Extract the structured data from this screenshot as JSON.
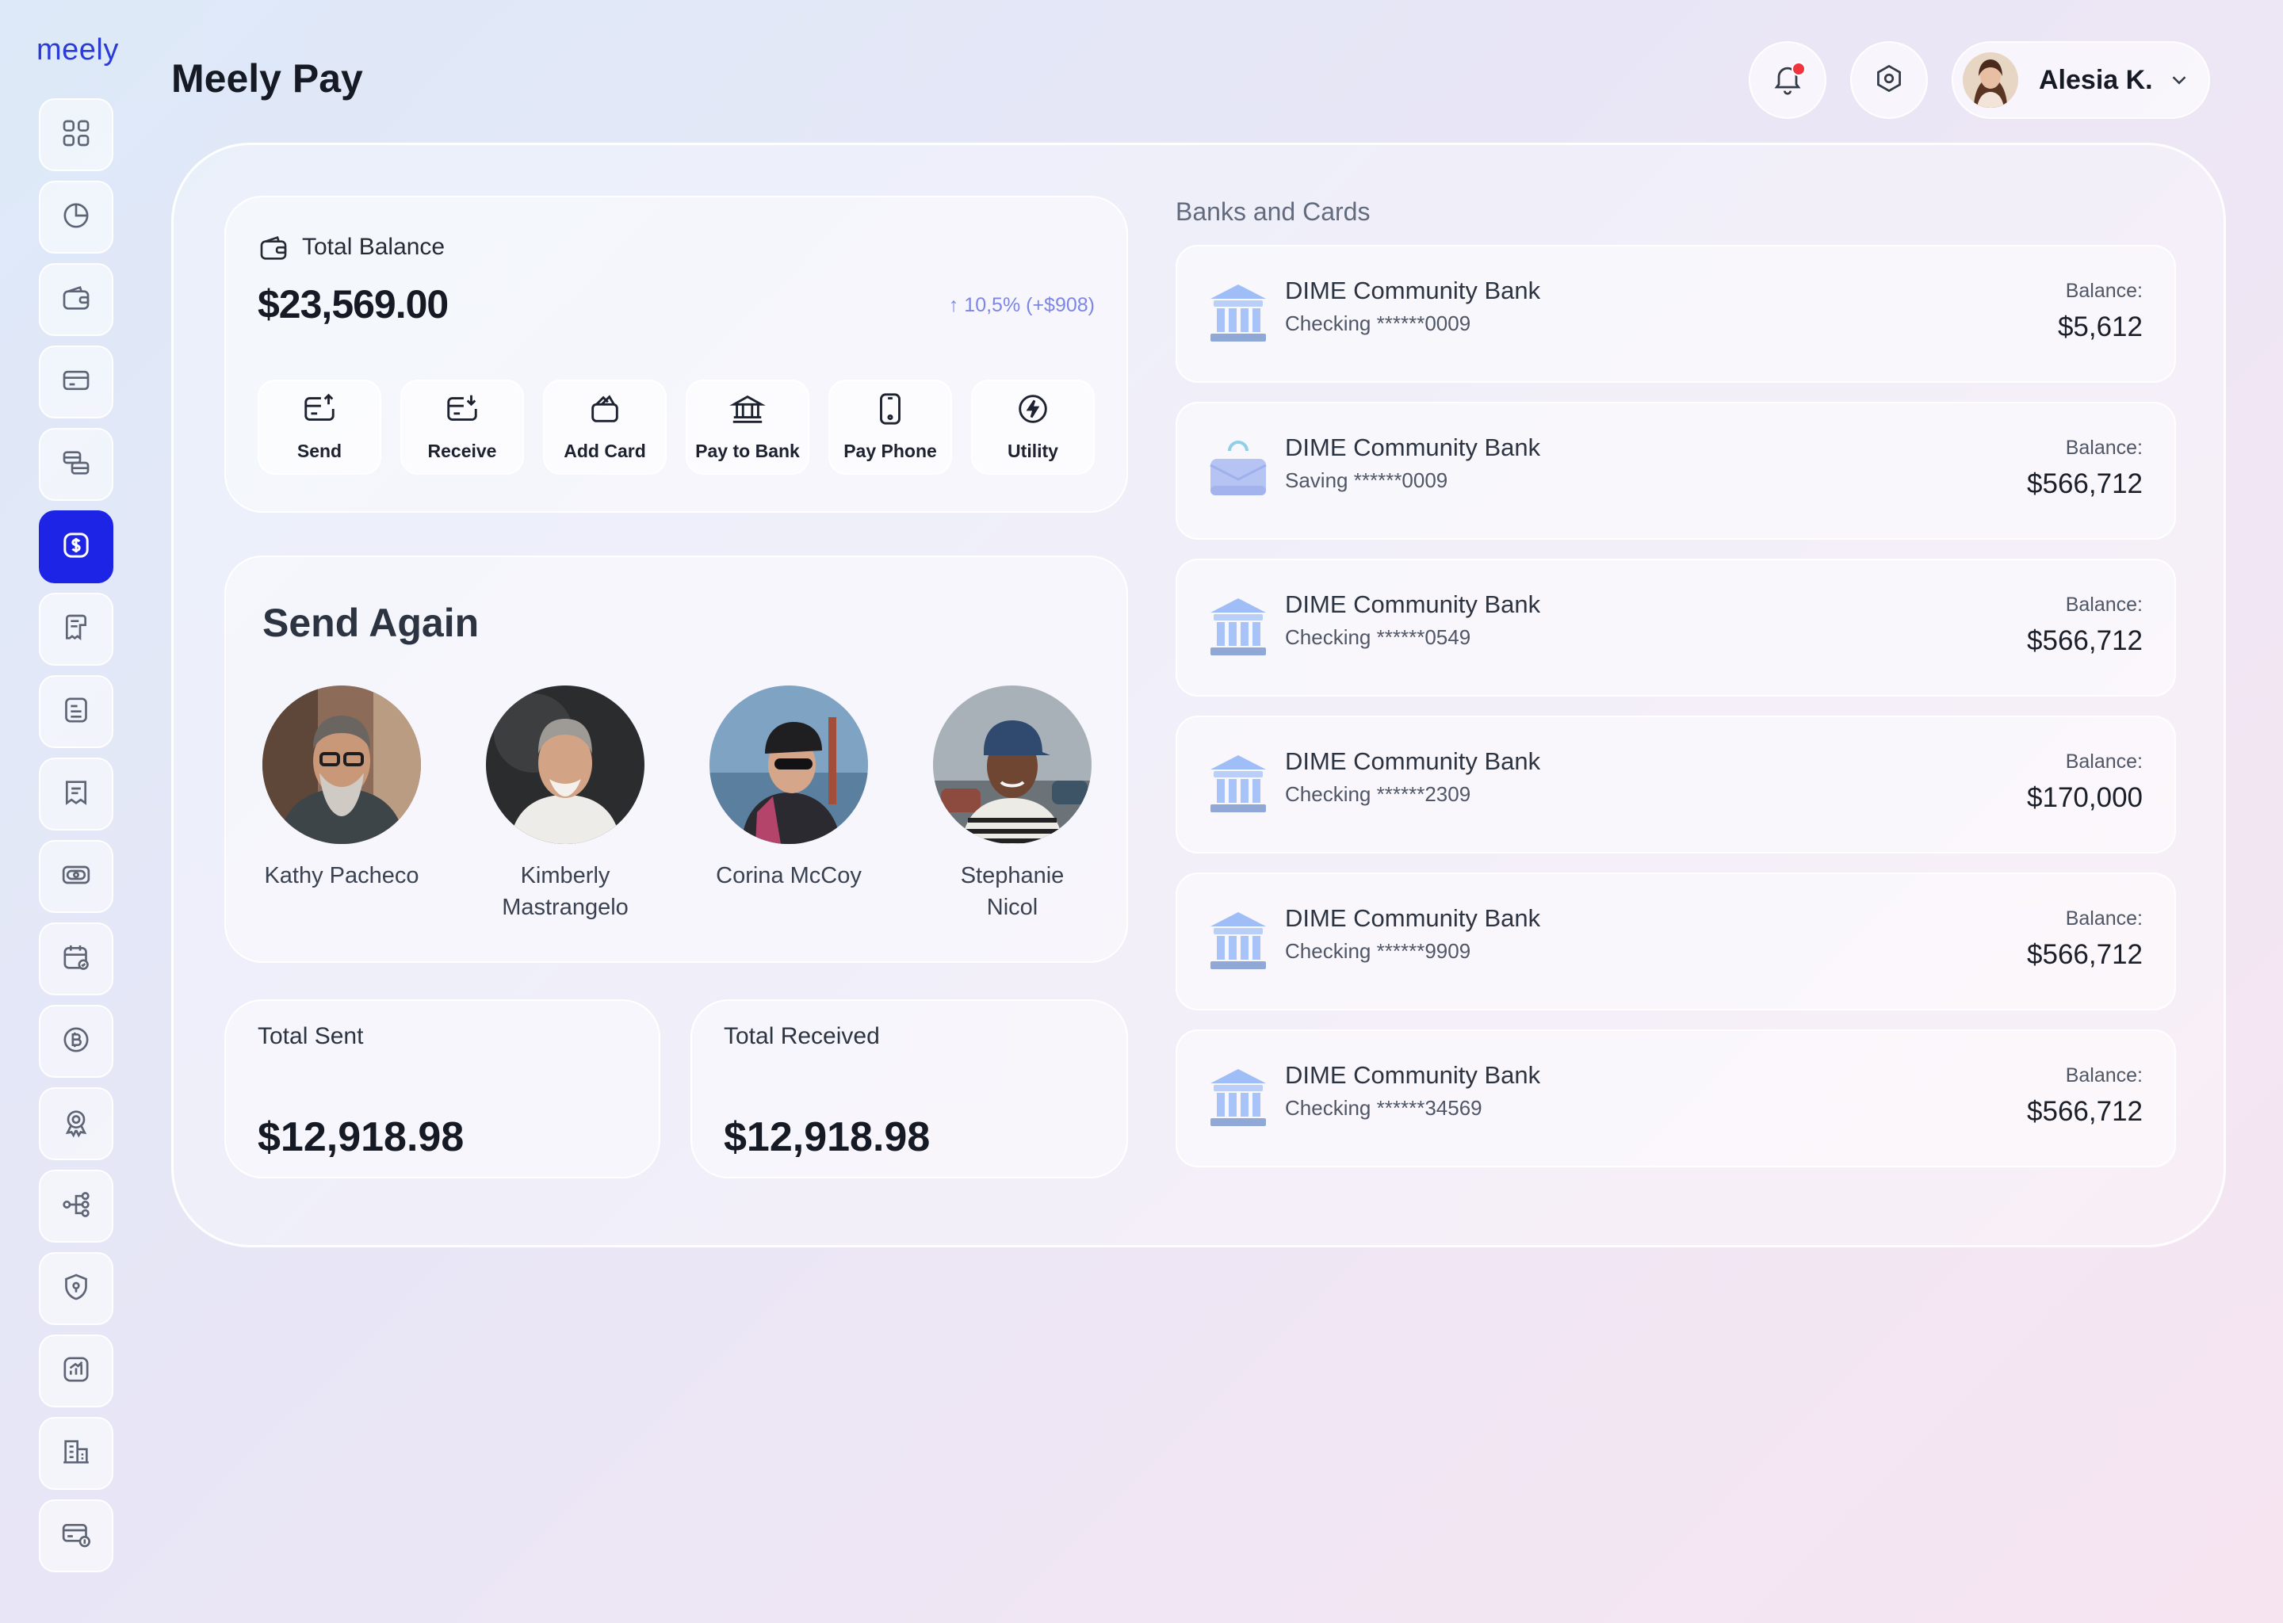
{
  "app": {
    "logo": "meely",
    "title": "Meely Pay"
  },
  "sidebar": {
    "items": [
      {
        "icon": "grid-icon"
      },
      {
        "icon": "pie-chart-icon"
      },
      {
        "icon": "wallet-icon"
      },
      {
        "icon": "credit-card-icon"
      },
      {
        "icon": "card-transfer-icon"
      },
      {
        "icon": "dollar-icon",
        "active": true
      },
      {
        "icon": "receipt-icon"
      },
      {
        "icon": "document-icon"
      },
      {
        "icon": "bill-icon"
      },
      {
        "icon": "cash-icon"
      },
      {
        "icon": "calendar-icon"
      },
      {
        "icon": "bitcoin-icon"
      },
      {
        "icon": "badge-icon"
      },
      {
        "icon": "network-icon"
      },
      {
        "icon": "shield-icon"
      },
      {
        "icon": "analytics-icon"
      },
      {
        "icon": "building-icon"
      },
      {
        "icon": "card-coin-icon"
      }
    ]
  },
  "header": {
    "user_name": "Alesia K.",
    "notification_dot_color": "#f0343d"
  },
  "balance": {
    "title": "Total Balance",
    "amount": "$23,569.00",
    "change": "10,5% (+$908)",
    "actions": [
      {
        "label": "Send",
        "icon": "send-icon"
      },
      {
        "label": "Receive",
        "icon": "receive-icon"
      },
      {
        "label": "Add Card",
        "icon": "add-card-icon"
      },
      {
        "label": "Pay to Bank",
        "icon": "bank-icon"
      },
      {
        "label": "Pay Phone",
        "icon": "phone-icon"
      },
      {
        "label": "Utility",
        "icon": "bolt-icon"
      }
    ]
  },
  "send_again": {
    "title": "Send Again",
    "contacts": [
      {
        "name": "Kathy Pacheco"
      },
      {
        "name": "Kimberly Mastrangelo"
      },
      {
        "name": "Corina McCoy"
      },
      {
        "name": "Stephanie Nicol"
      }
    ]
  },
  "totals": {
    "sent_label": "Total Sent",
    "sent_amount": "$12,918.98",
    "received_label": "Total Received",
    "received_amount": "$12,918.98"
  },
  "banks": {
    "title": "Banks and Cards",
    "items": [
      {
        "name": "DIME Community Bank",
        "account": "Checking ******0009",
        "balance_label": "Balance:",
        "balance": "$5,612",
        "icon": "bank-building-icon"
      },
      {
        "name": "DIME Community Bank",
        "account": "Saving ******0009",
        "balance_label": "Balance:",
        "balance": "$566,712",
        "icon": "savings-box-icon"
      },
      {
        "name": "DIME Community Bank",
        "account": "Checking ******0549",
        "balance_label": "Balance:",
        "balance": "$566,712",
        "icon": "bank-building-icon"
      },
      {
        "name": "DIME Community Bank",
        "account": "Checking ******2309",
        "balance_label": "Balance:",
        "balance": "$170,000",
        "icon": "bank-building-icon"
      },
      {
        "name": "DIME Community Bank",
        "account": "Checking ******9909",
        "balance_label": "Balance:",
        "balance": "$566,712",
        "icon": "bank-building-icon"
      },
      {
        "name": "DIME Community Bank",
        "account": "Checking ******34569",
        "balance_label": "Balance:",
        "balance": "$566,712",
        "icon": "bank-building-icon"
      }
    ]
  },
  "colors": {
    "accent": "#1d24e6",
    "change_text": "#7d86e6"
  }
}
